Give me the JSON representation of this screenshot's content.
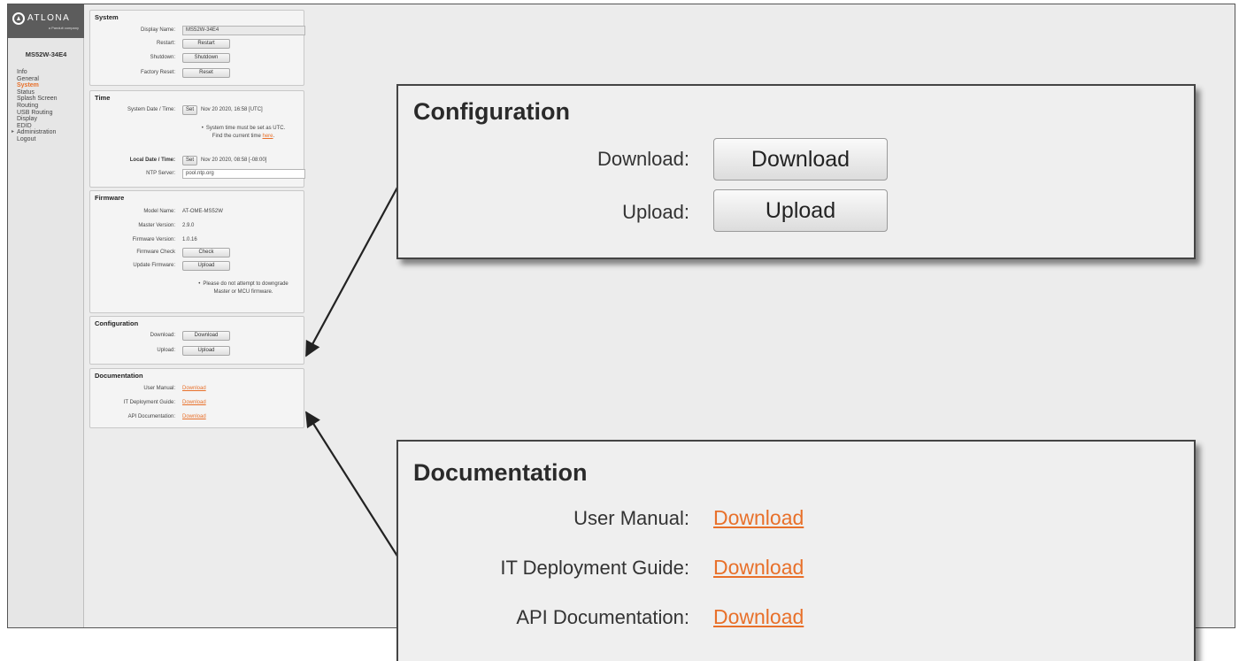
{
  "brand": {
    "logo_text": "ATLONA",
    "logo_subtext": "a Panduit company"
  },
  "sidebar": {
    "device_name": "MS52W-34E4",
    "items": [
      {
        "label": "Info"
      },
      {
        "label": "General"
      },
      {
        "label": "System"
      },
      {
        "label": "Status"
      },
      {
        "label": "Splash Screen"
      },
      {
        "label": "Routing"
      },
      {
        "label": "USB Routing"
      },
      {
        "label": "Display"
      },
      {
        "label": "EDID"
      },
      {
        "label": "Administration"
      },
      {
        "label": "Logout"
      }
    ]
  },
  "system": {
    "title": "System",
    "display_name_label": "Display Name:",
    "display_name_value": "MS52W-34E4",
    "restart_label": "Restart:",
    "restart_button": "Restart",
    "shutdown_label": "Shutdown:",
    "shutdown_button": "Shutdown",
    "factory_reset_label": "Factory Reset:",
    "reset_button": "Reset"
  },
  "time": {
    "title": "Time",
    "system_dt_label": "System Date / Time:",
    "set_button": "Set",
    "system_dt_value": "Nov 20 2020, 16:58 [UTC]",
    "note_line1": "System time must be set as UTC.",
    "note_line2": "Find the current time",
    "note_link": "here",
    "local_dt_label": "Local Date / Time:",
    "local_dt_value": "Nov 20 2020, 08:58 [-08:00]",
    "ntp_label": "NTP Server:",
    "ntp_value": "pool.ntp.org"
  },
  "firmware": {
    "title": "Firmware",
    "model_label": "Model Name:",
    "model_value": "AT-OME-MS52W",
    "master_label": "Master Version:",
    "master_value": "2.9.0",
    "fw_label": "Firmware Version:",
    "fw_value": "1.0.16",
    "check_label": "Firmware Check",
    "check_button": "Check",
    "update_label": "Update Firmware:",
    "upload_button": "Upload",
    "note_line1": "Please do not attempt to downgrade",
    "note_line2": "Master or MCU firmware."
  },
  "configuration": {
    "title": "Configuration",
    "download_label": "Download:",
    "download_button": "Download",
    "upload_label": "Upload:",
    "upload_button": "Upload"
  },
  "documentation": {
    "title": "Documentation",
    "user_manual_label": "User Manual:",
    "it_guide_label": "IT Deployment Guide:",
    "api_label": "API Documentation:",
    "link_text": "Download"
  },
  "colors": {
    "accent": "#e8702a",
    "sidebar_bg": "#e6e6e6",
    "panel_bg": "#f4f4f4",
    "logo_bg": "#5c5c5c"
  }
}
